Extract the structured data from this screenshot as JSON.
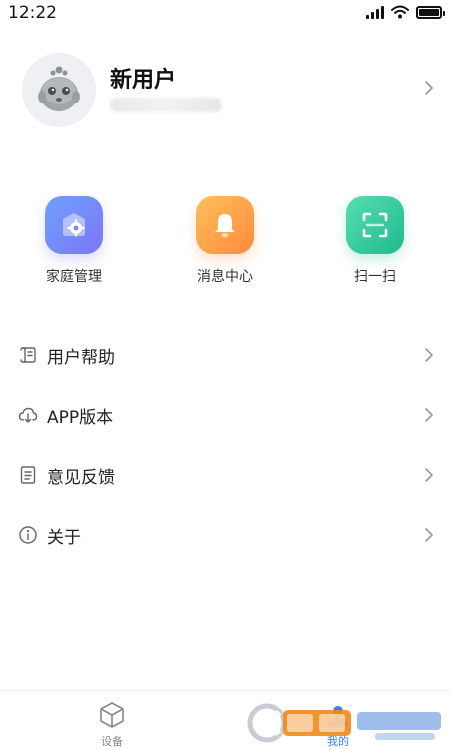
{
  "status_bar": {
    "time": "12:22"
  },
  "profile": {
    "name": "新用户"
  },
  "quick_actions": [
    {
      "label": "家庭管理",
      "icon": "home-gear-icon",
      "color": "#7b8cf7"
    },
    {
      "label": "消息中心",
      "icon": "bell-icon",
      "color": "#ffa04a"
    },
    {
      "label": "扫一扫",
      "icon": "scan-icon",
      "color": "#34c99a"
    }
  ],
  "menu": [
    {
      "label": "用户帮助",
      "icon": "help-scroll-icon"
    },
    {
      "label": "APP版本",
      "icon": "cloud-download-icon"
    },
    {
      "label": "意见反馈",
      "icon": "document-icon"
    },
    {
      "label": "关于",
      "icon": "info-icon"
    }
  ],
  "tabs": [
    {
      "label": "设备",
      "icon": "cube-icon",
      "active": false
    },
    {
      "label": "我的",
      "icon": "person-icon",
      "active": true
    }
  ],
  "colors": {
    "accent": "#3c7cff",
    "text": "#222222",
    "secondary": "#888888"
  }
}
